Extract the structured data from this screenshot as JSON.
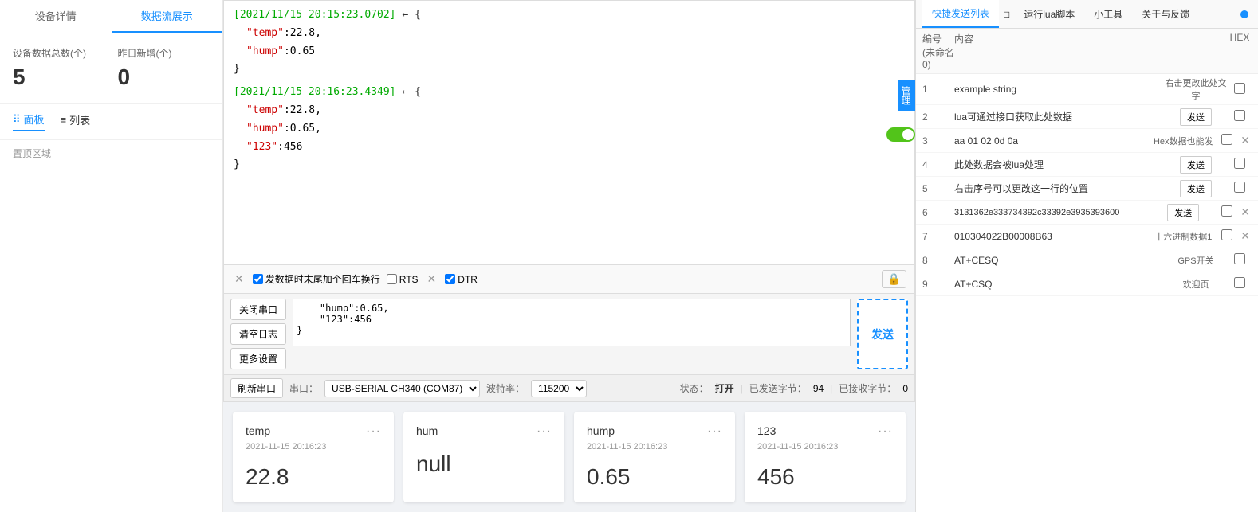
{
  "sidebar": {
    "tab1": "设备详情",
    "tab2": "数据流展示",
    "stats": {
      "total_label": "设备数据总数(个)",
      "new_label": "昨日新增(个)",
      "total_value": "5",
      "new_value": "0"
    },
    "view_panel": "面板",
    "view_list": "列表",
    "section_top": "置顶区域"
  },
  "serial": {
    "log_entries": [
      {
        "timestamp": "[2021/11/15 20:15:23.0702]",
        "direction": "←",
        "content": "{\n    \"temp\":22.8,\n    \"hump\":0.65\n}"
      },
      {
        "timestamp": "[2021/11/15 20:16:23.4349]",
        "direction": "←",
        "content": "{\n    \"temp\":22.8,\n    \"hump\":0.65,\n    \"123\":456\n}"
      }
    ],
    "input_text": "    \"hump\":0.65,\n    \"123\":456\n}",
    "controls": {
      "newline_label": "发数据时末尾加个回车换行",
      "rts_label": "RTS",
      "dtr_label": "DTR"
    },
    "buttons": {
      "close": "关闭串口",
      "clear": "清空日志",
      "more": "更多设置",
      "send": "发送",
      "refresh": "刷新串口"
    },
    "bottom": {
      "port_label": "串口：",
      "port_value": "USB-SERIAL CH340 (COM87)",
      "baud_label": "波特率：",
      "baud_value": "115200",
      "status_label": "状态：",
      "status_value": "打开",
      "sent_label": "已发送字节：",
      "sent_value": "94",
      "recv_label": "已接收字节：",
      "recv_value": "0"
    }
  },
  "quick_send": {
    "tabs": [
      "快捷发送列表",
      "运行lua脚本",
      "小工具",
      "关于与反馈"
    ],
    "active_tab": 0,
    "header": {
      "num": "编号 (未命名0)",
      "content": "内容",
      "hex": "HEX"
    },
    "rows": [
      {
        "num": 1,
        "content": "example string",
        "action": "右击更改此处文字",
        "hex": false,
        "closable": false
      },
      {
        "num": 2,
        "content": "lua可通过接口获取此处数据",
        "action": "发送",
        "hex": false,
        "closable": false
      },
      {
        "num": 3,
        "content": "aa 01 02 0d 0a",
        "action": "Hex数据也能发",
        "hex": false,
        "closable": true
      },
      {
        "num": 4,
        "content": "此处数据会被lua处理",
        "action": "发送",
        "hex": false,
        "closable": false
      },
      {
        "num": 5,
        "content": "右击序号可以更改这一行的位置",
        "action": "发送",
        "hex": false,
        "closable": false
      },
      {
        "num": 6,
        "content": "3131362e333734392c33392e3935393600",
        "action": "发送",
        "hex": false,
        "closable": true
      },
      {
        "num": 7,
        "content": "010304022B00008B63",
        "action": "十六进制数据1",
        "hex": false,
        "closable": true
      },
      {
        "num": 8,
        "content": "AT+CESQ",
        "action": "GPS开关",
        "hex": false,
        "closable": false
      },
      {
        "num": 9,
        "content": "AT+CSQ",
        "action": "欢迎页",
        "hex": false,
        "closable": false
      }
    ]
  },
  "data_cards": [
    {
      "name": "temp",
      "time": "2021-11-15 20:16:23",
      "value": "22.8"
    },
    {
      "name": "hum",
      "time": "",
      "value": "null"
    },
    {
      "name": "hump",
      "time": "2021-11-15 20:16:23",
      "value": "0.65"
    },
    {
      "name": "123",
      "time": "2021-11-15 20:16:23",
      "value": "456"
    }
  ],
  "management_btn": "管理"
}
